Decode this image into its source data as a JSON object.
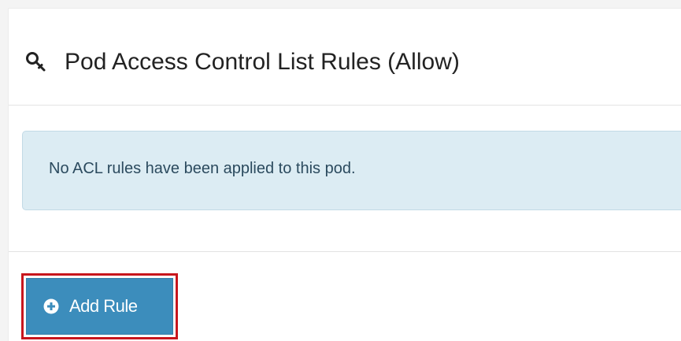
{
  "header": {
    "icon": "key-icon",
    "title": "Pod Access Control List Rules (Allow)"
  },
  "alert": {
    "message": "No ACL rules have been applied to this pod."
  },
  "actions": {
    "add_rule_icon": "plus-circle-icon",
    "add_rule_label": "Add Rule"
  },
  "colors": {
    "primary_button": "#3c8dbc",
    "info_callout_bg": "#dcecf3",
    "highlight_border": "#c8161d"
  }
}
